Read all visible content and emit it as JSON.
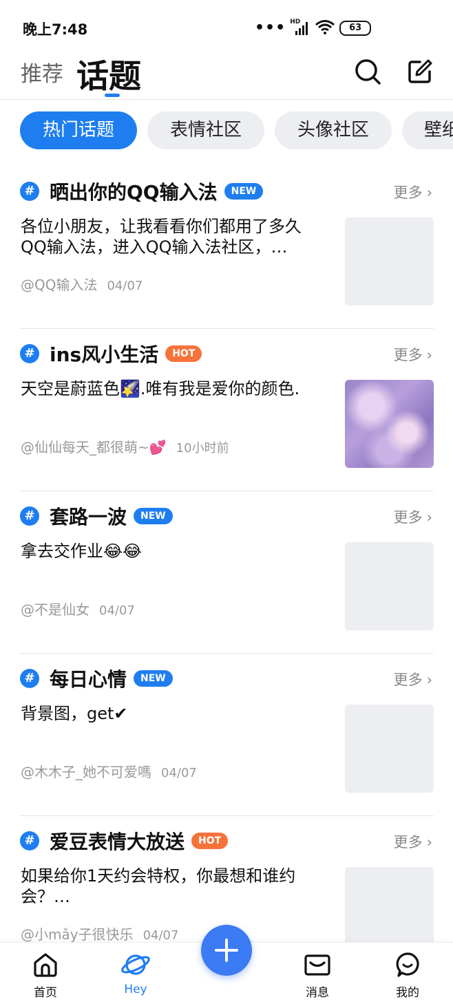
{
  "status": {
    "time": "晚上7:48",
    "signal": "HD",
    "battery": "63"
  },
  "nav": {
    "tab_recommend": "推荐",
    "tab_topic": "话题"
  },
  "chips": [
    "热门话题",
    "表情社区",
    "头像社区",
    "壁纸"
  ],
  "more_label": "更多",
  "posts": [
    {
      "title": "晒出你的QQ输入法",
      "badge": "NEW",
      "body": "各位小朋友，让我看看你们都用了多久QQ输入法，进入QQ输入法社区，…",
      "author": "@QQ输入法",
      "date": "04/07"
    },
    {
      "title": "ins风小生活",
      "badge": "HOT",
      "body": "天空是蔚蓝色🌠.唯有我是爱你的颜色.",
      "author": "@仙仙每天_都很萌~💕",
      "date": "10小时前"
    },
    {
      "title": "套路一波",
      "badge": "NEW",
      "body": "拿去交作业😂😂",
      "author": "@不是仙女",
      "date": "04/07"
    },
    {
      "title": "每日心情",
      "badge": "NEW",
      "body": "背景图，get✔",
      "author": "@木木子_她不可爱嗎",
      "date": "04/07"
    },
    {
      "title": "爱豆表情大放送",
      "badge": "HOT",
      "body": "如果给你1天约会特权，你最想和谁约会？…",
      "author": "@小mǎy子很快乐",
      "date": "04/07"
    }
  ],
  "tabbar": {
    "home": "首页",
    "hey": "Hey",
    "messages": "消息",
    "mine": "我的"
  },
  "colors": {
    "accent": "#1e7ef0",
    "hot": "#f5733b",
    "fab": "#3b7bf3"
  }
}
